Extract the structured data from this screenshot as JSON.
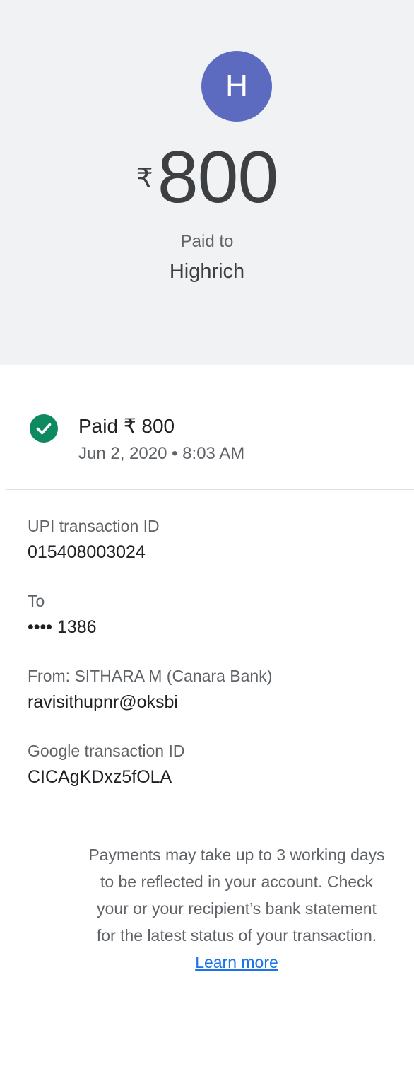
{
  "header": {
    "avatar_letter": "H",
    "currency_symbol": "₹",
    "amount": "800",
    "paid_to_label": "Paid to",
    "payee_name": "Highrich"
  },
  "status": {
    "title": "Paid ₹ 800",
    "datetime": "Jun 2, 2020 • 8:03 AM",
    "icon": "check-circle-icon",
    "color": "#0d8a5f"
  },
  "details": [
    {
      "label": "UPI transaction ID",
      "value": "015408003024"
    },
    {
      "label": "To",
      "value": "•••• 1386"
    },
    {
      "label": "From: SITHARA M (Canara Bank)",
      "value": "ravisithupnr@oksbi"
    },
    {
      "label": "Google transaction ID",
      "value": "CICAgKDxz5fOLA"
    }
  ],
  "notice": {
    "lines": [
      "Payments may take up to 3 working days",
      "to be reflected in your account. Check",
      "your or your recipient’s bank statement",
      "for the latest status of your transaction."
    ],
    "link_label": "Learn more",
    "link_color": "#1a73e8"
  },
  "colors": {
    "header_bg": "#f1f2f4",
    "avatar_bg": "#5c6bc0"
  }
}
